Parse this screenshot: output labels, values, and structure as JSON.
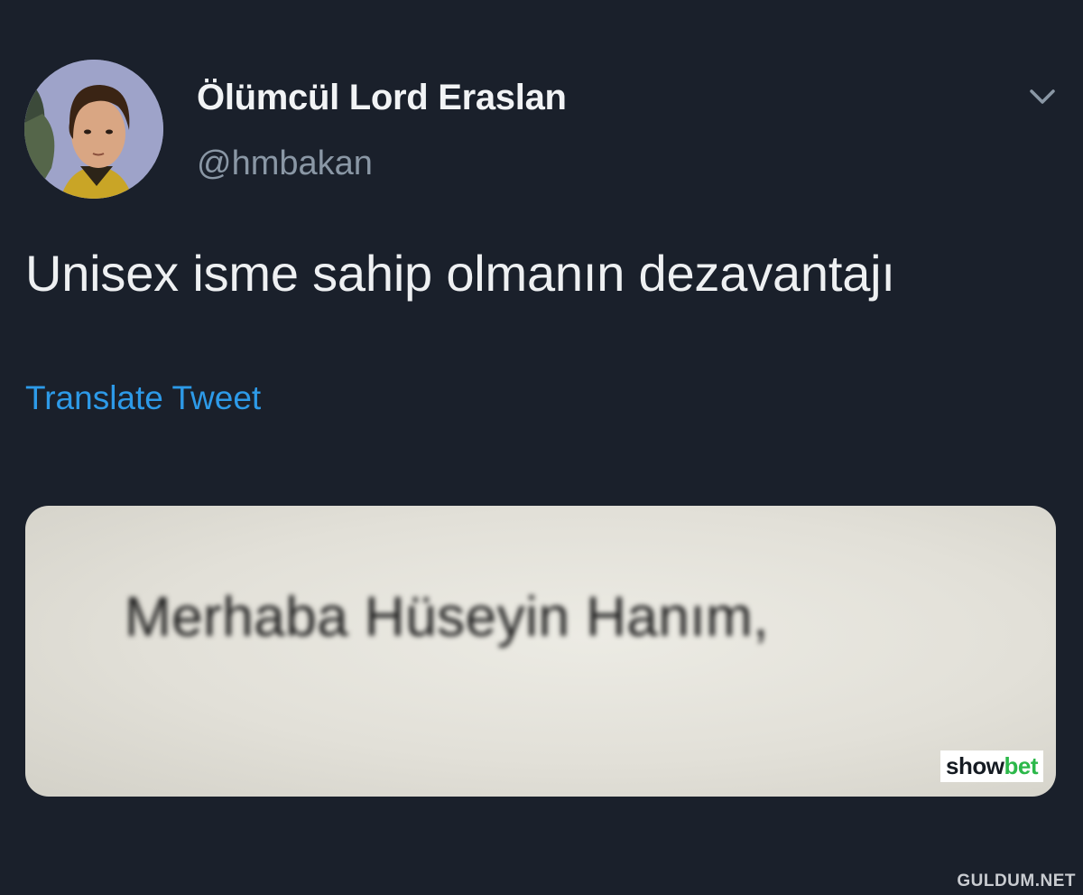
{
  "tweet": {
    "author": {
      "display_name": "Ölümcül Lord Eraslan",
      "handle": "@hmbakan",
      "avatar_icon": "profile-photo"
    },
    "menu_icon": "chevron-down-icon",
    "text": "Unisex isme sahip olmanın dezavantajı",
    "translate_label": "Translate Tweet",
    "media": {
      "caption_text": "Merhaba Hüseyin Hanım,",
      "brand_part1": "show",
      "brand_part2": "bet"
    }
  },
  "watermark": "GULDUM.NET",
  "colors": {
    "background": "#1a202b",
    "link": "#2d9ae8",
    "handle": "#8a97a5",
    "brand_green": "#2cb84a"
  }
}
